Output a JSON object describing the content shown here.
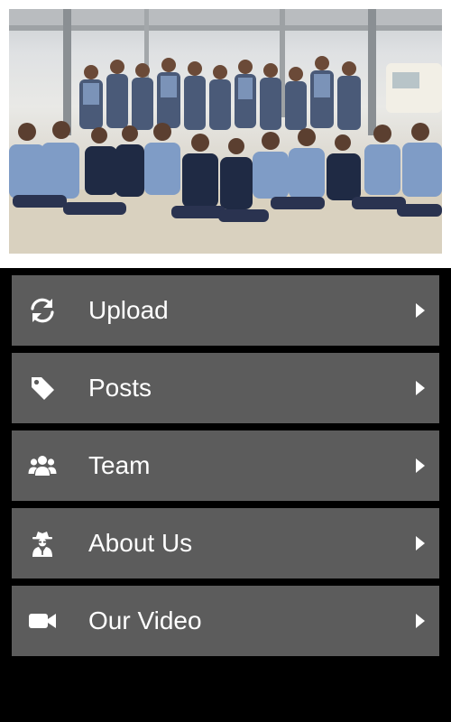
{
  "header": {
    "photo": "group-photo"
  },
  "menu": {
    "items": [
      {
        "label": "Upload",
        "icon": "refresh-icon"
      },
      {
        "label": "Posts",
        "icon": "tag-icon"
      },
      {
        "label": "Team",
        "icon": "users-icon"
      },
      {
        "label": "About Us",
        "icon": "spy-icon"
      },
      {
        "label": "Our Video",
        "icon": "video-camera-icon"
      }
    ],
    "chevron_icon": "chevron-right-icon"
  },
  "colors": {
    "background": "#000000",
    "menu_item_bg": "#5c5c5c",
    "text": "#ffffff",
    "photo_border": "#ffffff"
  }
}
